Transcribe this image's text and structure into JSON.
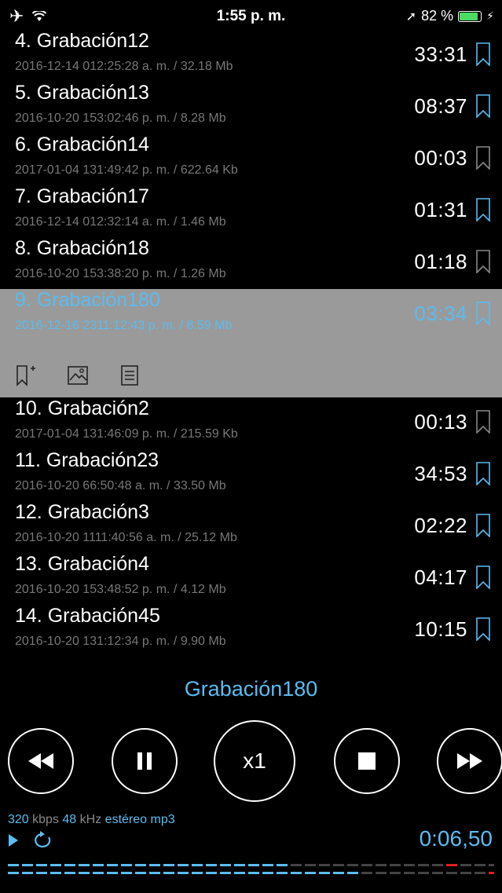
{
  "status": {
    "time": "1:55 p. m.",
    "battery": "82 %",
    "battery_level": 0.82,
    "icons": [
      "airplane-icon",
      "wifi-icon",
      "location-arrow-icon",
      "battery-icon",
      "charging-icon"
    ]
  },
  "recordings": [
    {
      "title": "4. Grabación12",
      "meta": "2016-12-14 012:25:28 a. m. / 32.18 Mb",
      "duration": "33:31",
      "bookmarked": true
    },
    {
      "title": "5. Grabación13",
      "meta": "2016-10-20 153:02:46 p. m. / 8.28 Mb",
      "duration": "08:37",
      "bookmarked": true
    },
    {
      "title": "6. Grabación14",
      "meta": "2017-01-04 131:49:42 p. m. / 622.64 Kb",
      "duration": "00:03",
      "bookmarked": false
    },
    {
      "title": "7. Grabación17",
      "meta": "2016-12-14 012:32:14 a. m. / 1.46 Mb",
      "duration": "01:31",
      "bookmarked": true
    },
    {
      "title": "8. Grabación18",
      "meta": "2016-10-20 153:38:20 p. m. / 1.26 Mb",
      "duration": "01:18",
      "bookmarked": false
    },
    {
      "title": "9. Grabación180",
      "meta": "2016-12-16 2311:12:43 p. m. / 8.59 Mb",
      "duration": "03:34",
      "bookmarked": false,
      "selected": true
    },
    {
      "title": "10. Grabación2",
      "meta": "2017-01-04 131:46:09 p. m. / 215.59 Kb",
      "duration": "00:13",
      "bookmarked": false
    },
    {
      "title": "11. Grabación23",
      "meta": "2016-10-20 66:50:48 a. m. / 33.50 Mb",
      "duration": "34:53",
      "bookmarked": true
    },
    {
      "title": "12. Grabación3",
      "meta": "2016-10-20 1111:40:56 a. m. / 25.12 Mb",
      "duration": "02:22",
      "bookmarked": true
    },
    {
      "title": "13. Grabación4",
      "meta": "2016-10-20 153:48:52 p. m. / 4.12 Mb",
      "duration": "04:17",
      "bookmarked": true
    },
    {
      "title": "14. Grabación45",
      "meta": "2016-10-20 131:12:34 p. m. / 9.90 Mb",
      "duration": "10:15",
      "bookmarked": true
    }
  ],
  "row_actions": [
    "add-bookmark-icon",
    "image-icon",
    "notes-icon"
  ],
  "player": {
    "now_playing": "Grabación180",
    "speed": "x1",
    "bitrate": "320",
    "bitrate_unit": "kbps",
    "samplerate": "48",
    "samplerate_unit": "kHz",
    "channels": "estéreo",
    "format": "mp3",
    "elapsed": "0:06,50"
  },
  "colors": {
    "accent": "#5bbcf0",
    "selected_row": "#9a9a9a",
    "background": "#000000",
    "meter_peak": "#e02020"
  }
}
